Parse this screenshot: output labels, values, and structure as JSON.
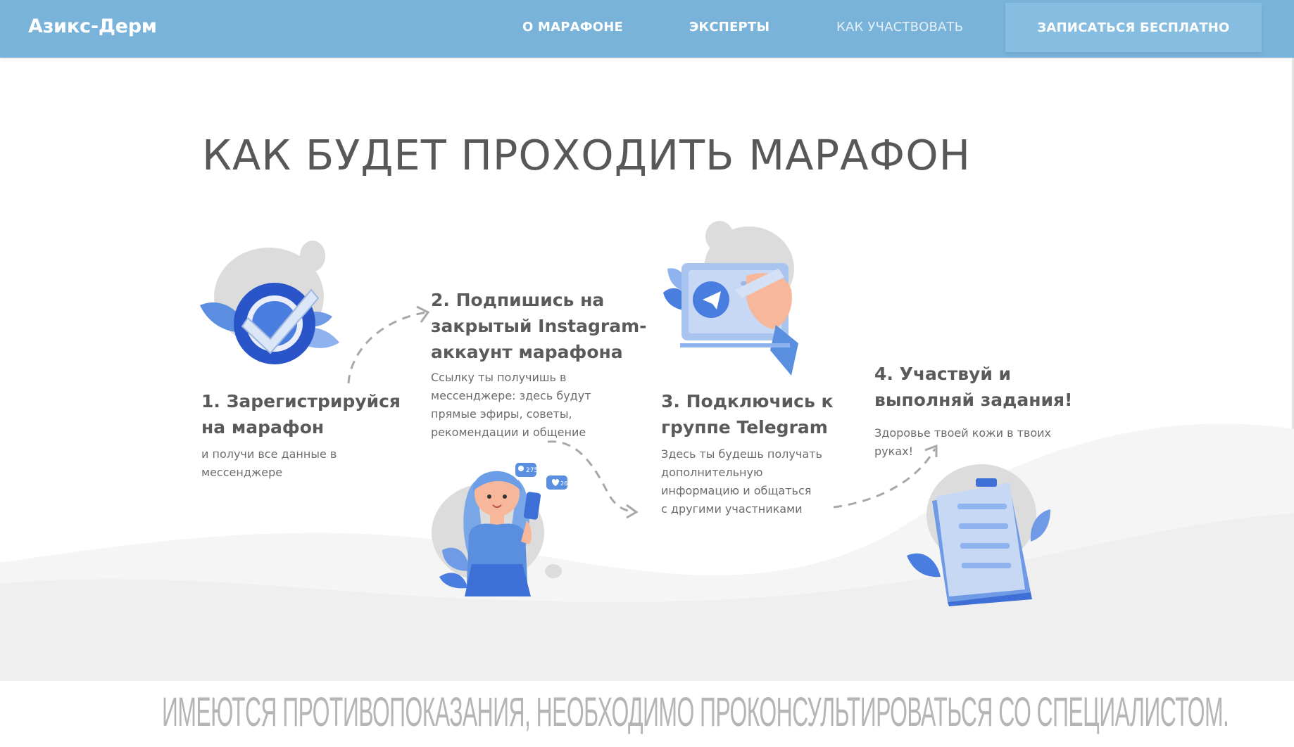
{
  "header": {
    "logo": "Азикс-Дерм",
    "nav": [
      {
        "label": "О МАРАФОНЕ"
      },
      {
        "label": "ЭКСПЕРТЫ"
      },
      {
        "label": "КАК УЧАСТВОВАТЬ"
      }
    ],
    "cta_label": "ЗАПИСАТЬСЯ БЕСПЛАТНО"
  },
  "main": {
    "title": "КАК БУДЕТ ПРОХОДИТЬ МАРАФОН",
    "steps": [
      {
        "title_lines": [
          "1. Зарегистрируйся",
          "на марафон"
        ],
        "desc_lines": [
          "и получи все данные в",
          "мессенджере"
        ]
      },
      {
        "title_lines": [
          "2. Подпишись на",
          "закрытый Instagram-",
          "аккаунт марафона"
        ],
        "desc_lines": [
          "Ссылку ты получишь в",
          "мессенджере: здесь будут",
          "прямые эфиры, советы,",
          "рекомендации и общение"
        ]
      },
      {
        "title_lines": [
          "3. Подключись к",
          "группе Telegram"
        ],
        "desc_lines": [
          "Здесь ты будешь получать",
          "дополнительную",
          "информацию и общаться",
          "с другими участниками"
        ]
      },
      {
        "title_lines": [
          "4. Участвуй и",
          "выполняй задания!"
        ],
        "desc_lines": [
          "Здоровье твоей кожи в твоих",
          "руках!"
        ]
      }
    ],
    "badges": [
      "275",
      "26"
    ]
  },
  "footer": {
    "disclaimer": "ИМЕЮТСЯ ПРОТИВОПОКАЗАНИЯ, НЕОБХОДИМО ПРОКОНСУЛЬТИРОВАТЬСЯ СО СПЕЦИАЛИСТОМ."
  },
  "colors": {
    "header_bg": "#79b3da",
    "cta_bg": "#86bde0",
    "title_text": "#585858",
    "accent_blue": "#3d6fd6",
    "wave_gray": "#f2f2f2"
  },
  "icons": [
    "checkmark-badge-icon",
    "telegram-icon",
    "clipboard-icon",
    "chat-icon",
    "heart-icon",
    "leaf-icon"
  ]
}
